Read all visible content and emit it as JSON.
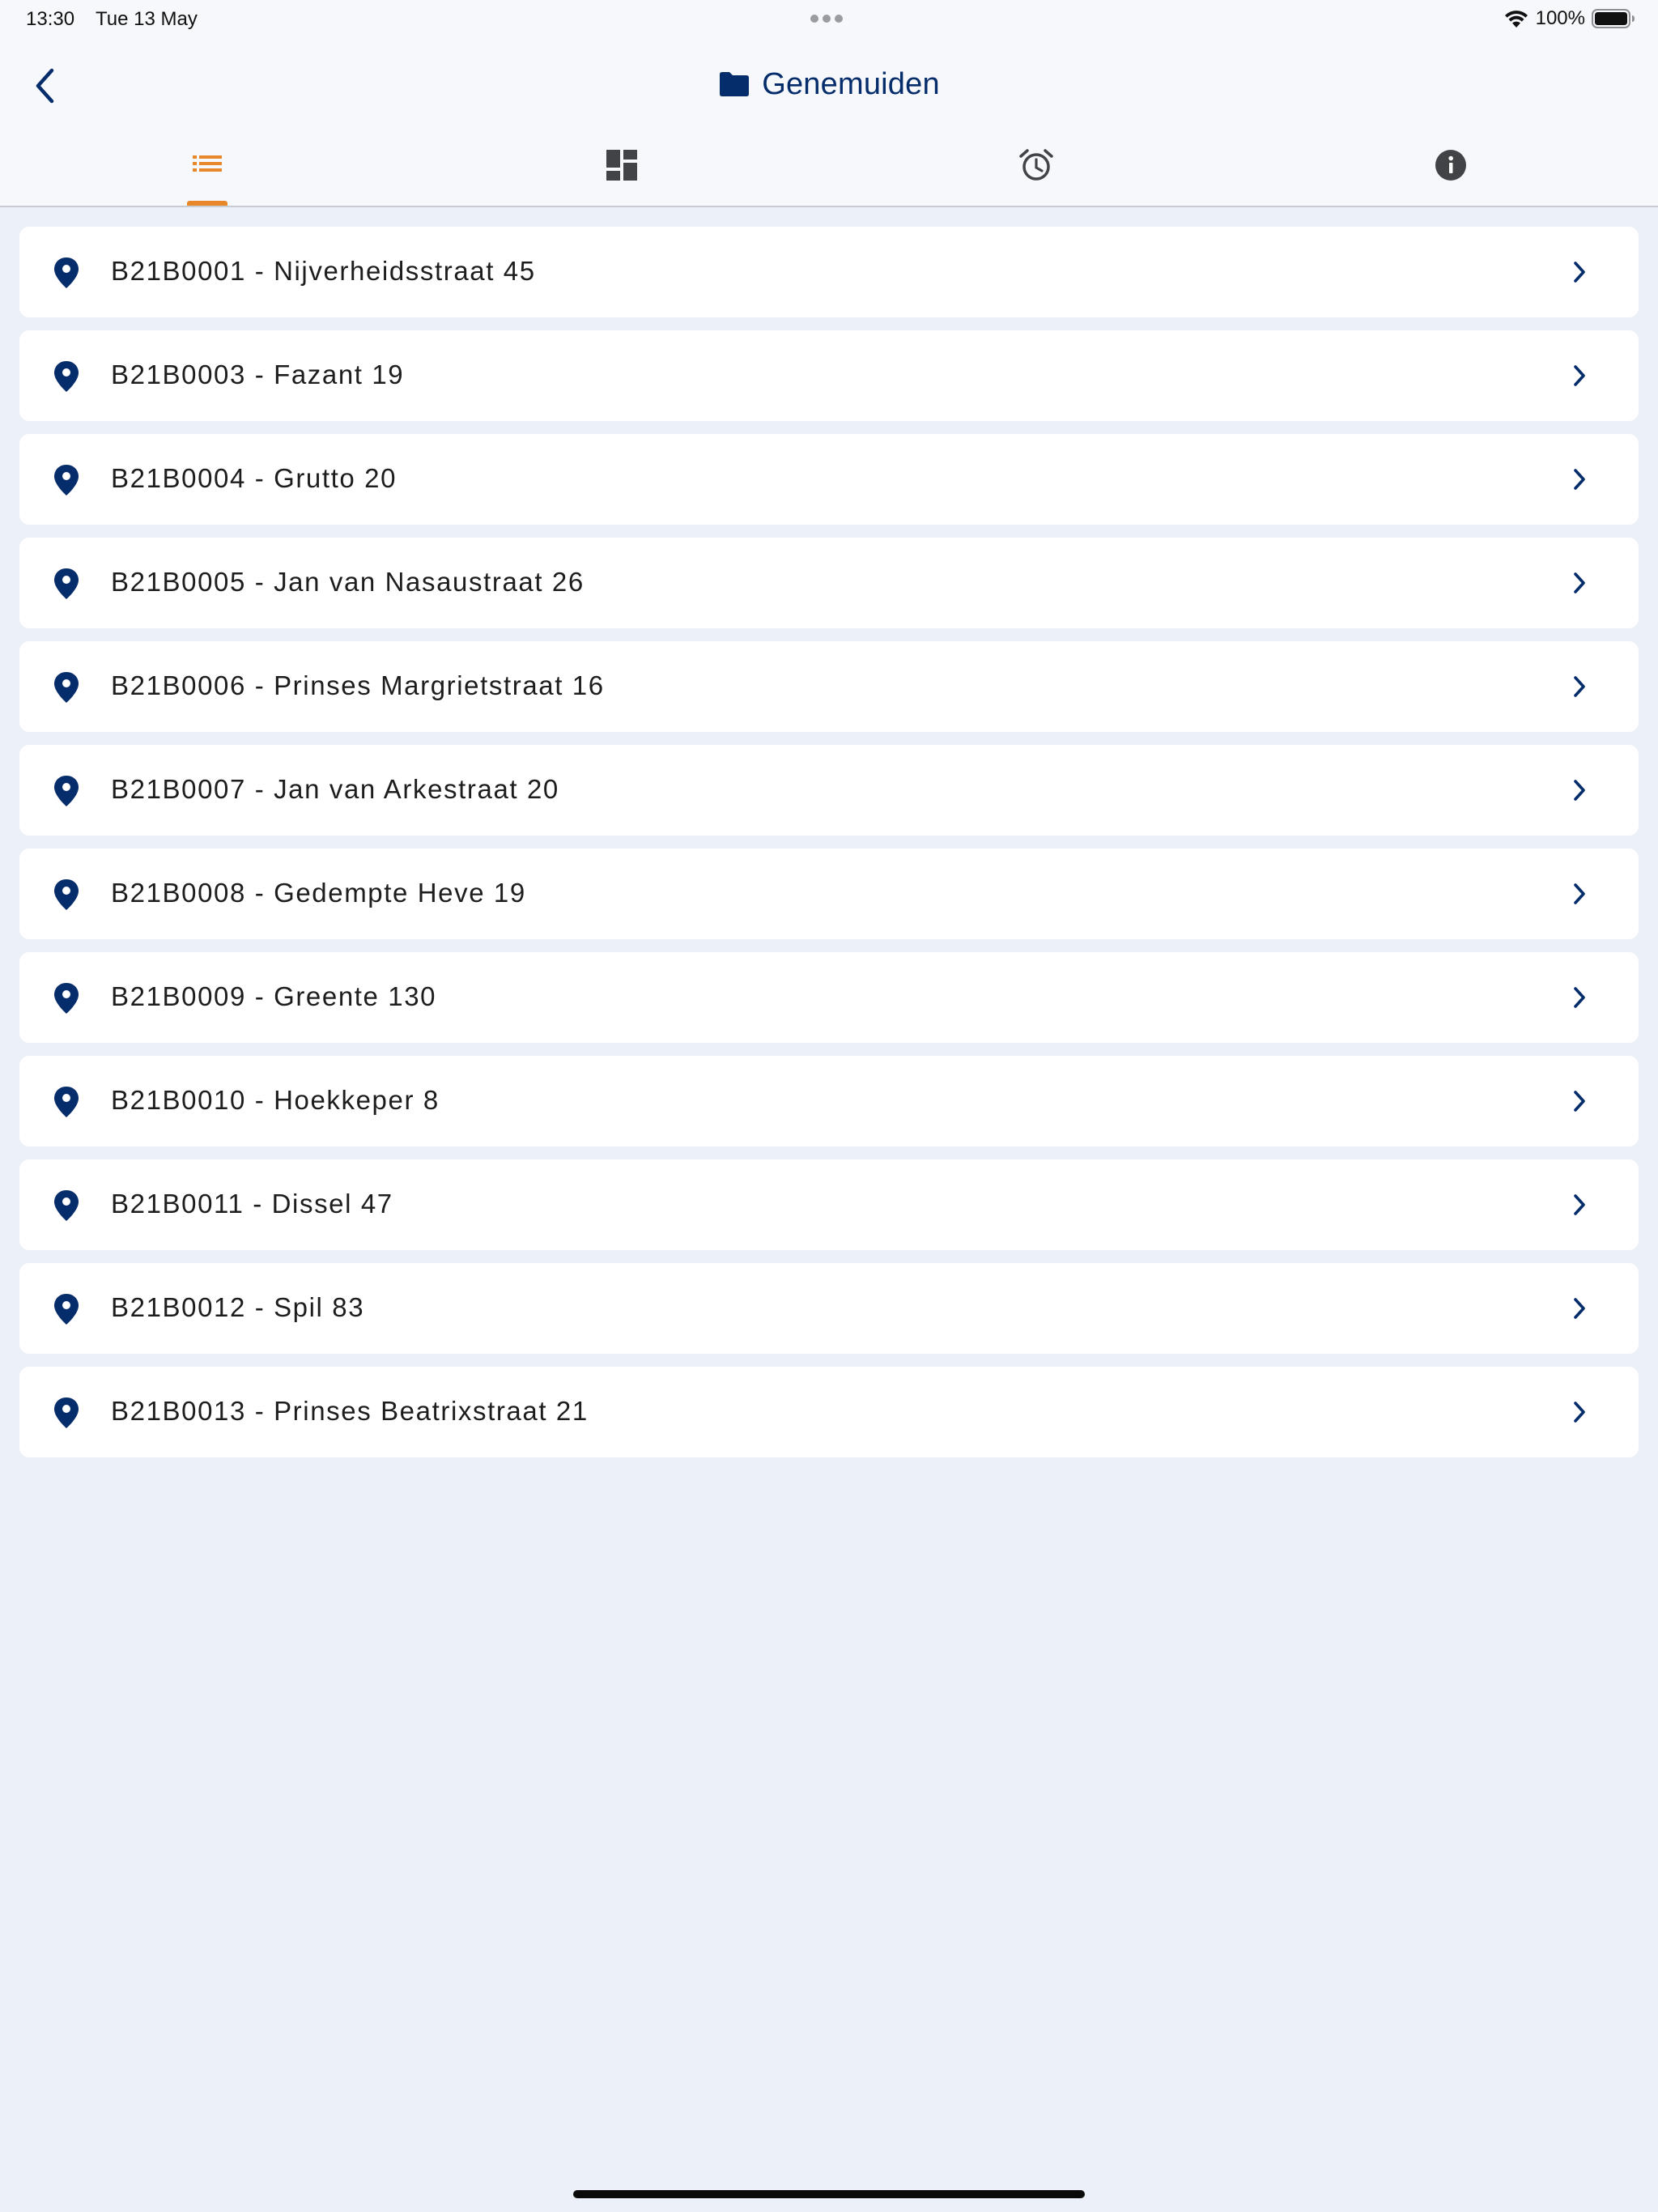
{
  "status_bar": {
    "time": "13:30",
    "date": "Tue 13 May",
    "battery": "100%"
  },
  "nav": {
    "title": "Genemuiden",
    "title_icon": "folder-icon",
    "back_icon": "chevron-left-icon"
  },
  "tabs": [
    {
      "icon": "list-icon",
      "active": true
    },
    {
      "icon": "dashboard-icon",
      "active": false
    },
    {
      "icon": "alarm-clock-icon",
      "active": false
    },
    {
      "icon": "info-icon",
      "active": false
    }
  ],
  "colors": {
    "brand": "#052d6b",
    "accent": "#e8872a",
    "background": "#ecf0f8",
    "card": "#ffffff"
  },
  "locations": [
    {
      "label": "B21B0001 - Nijverheidsstraat 45"
    },
    {
      "label": "B21B0003 - Fazant 19"
    },
    {
      "label": "B21B0004 - Grutto 20"
    },
    {
      "label": "B21B0005 - Jan van Nasaustraat 26"
    },
    {
      "label": "B21B0006 - Prinses Margrietstraat 16"
    },
    {
      "label": "B21B0007 - Jan van Arkestraat 20"
    },
    {
      "label": "B21B0008 - Gedempte Heve 19"
    },
    {
      "label": "B21B0009 - Greente 130"
    },
    {
      "label": "B21B0010 - Hoekkeper 8"
    },
    {
      "label": "B21B0011 - Dissel 47"
    },
    {
      "label": "B21B0012 - Spil 83"
    },
    {
      "label": "B21B0013 - Prinses Beatrixstraat 21"
    }
  ]
}
